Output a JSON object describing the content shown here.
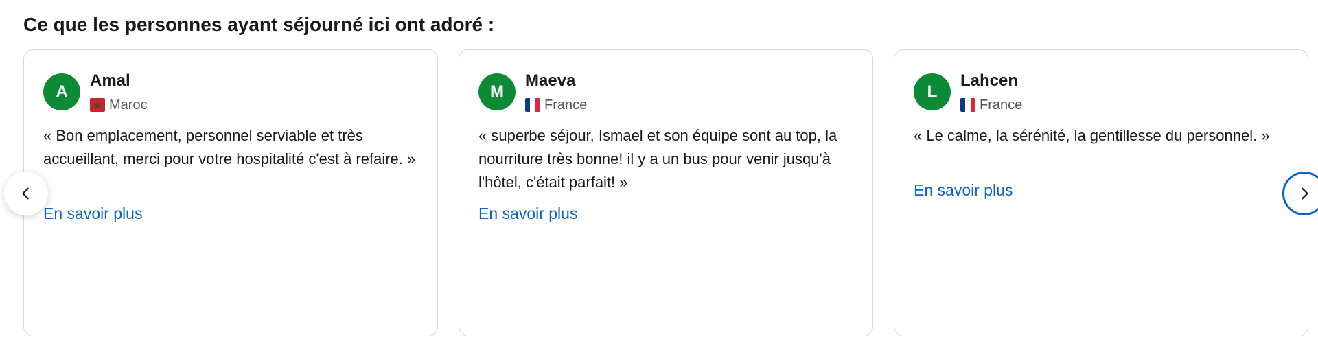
{
  "section": {
    "heading": "Ce que les personnes ayant séjourné ici ont adoré :"
  },
  "colors": {
    "avatar_bg": "#0d8a35",
    "link": "#0b64c8",
    "card_border": "#d9d9d9"
  },
  "reviews": [
    {
      "initial": "A",
      "name": "Amal",
      "country": "Maroc",
      "flag_icon": "morocco-flag-icon",
      "text": "« Bon emplacement, personnel serviable et très accueillant, merci pour votre hospitalité c'est à refaire. »",
      "link_label": "En savoir plus"
    },
    {
      "initial": "M",
      "name": "Maeva",
      "country": "France",
      "flag_icon": "france-flag-icon",
      "text": "« superbe séjour, Ismael et son équipe sont au top, la nourriture très bonne! il y a un bus pour venir jusqu'à l'hôtel, c'était parfait! »",
      "link_label": "En savoir plus"
    },
    {
      "initial": "L",
      "name": "Lahcen",
      "country": "France",
      "flag_icon": "france-flag-icon",
      "text": "« Le calme, la sérénité, la gentillesse du personnel. »",
      "link_label": "En savoir plus"
    }
  ],
  "navigation": {
    "prev_icon": "chevron-left-icon",
    "next_icon": "chevron-right-icon"
  }
}
